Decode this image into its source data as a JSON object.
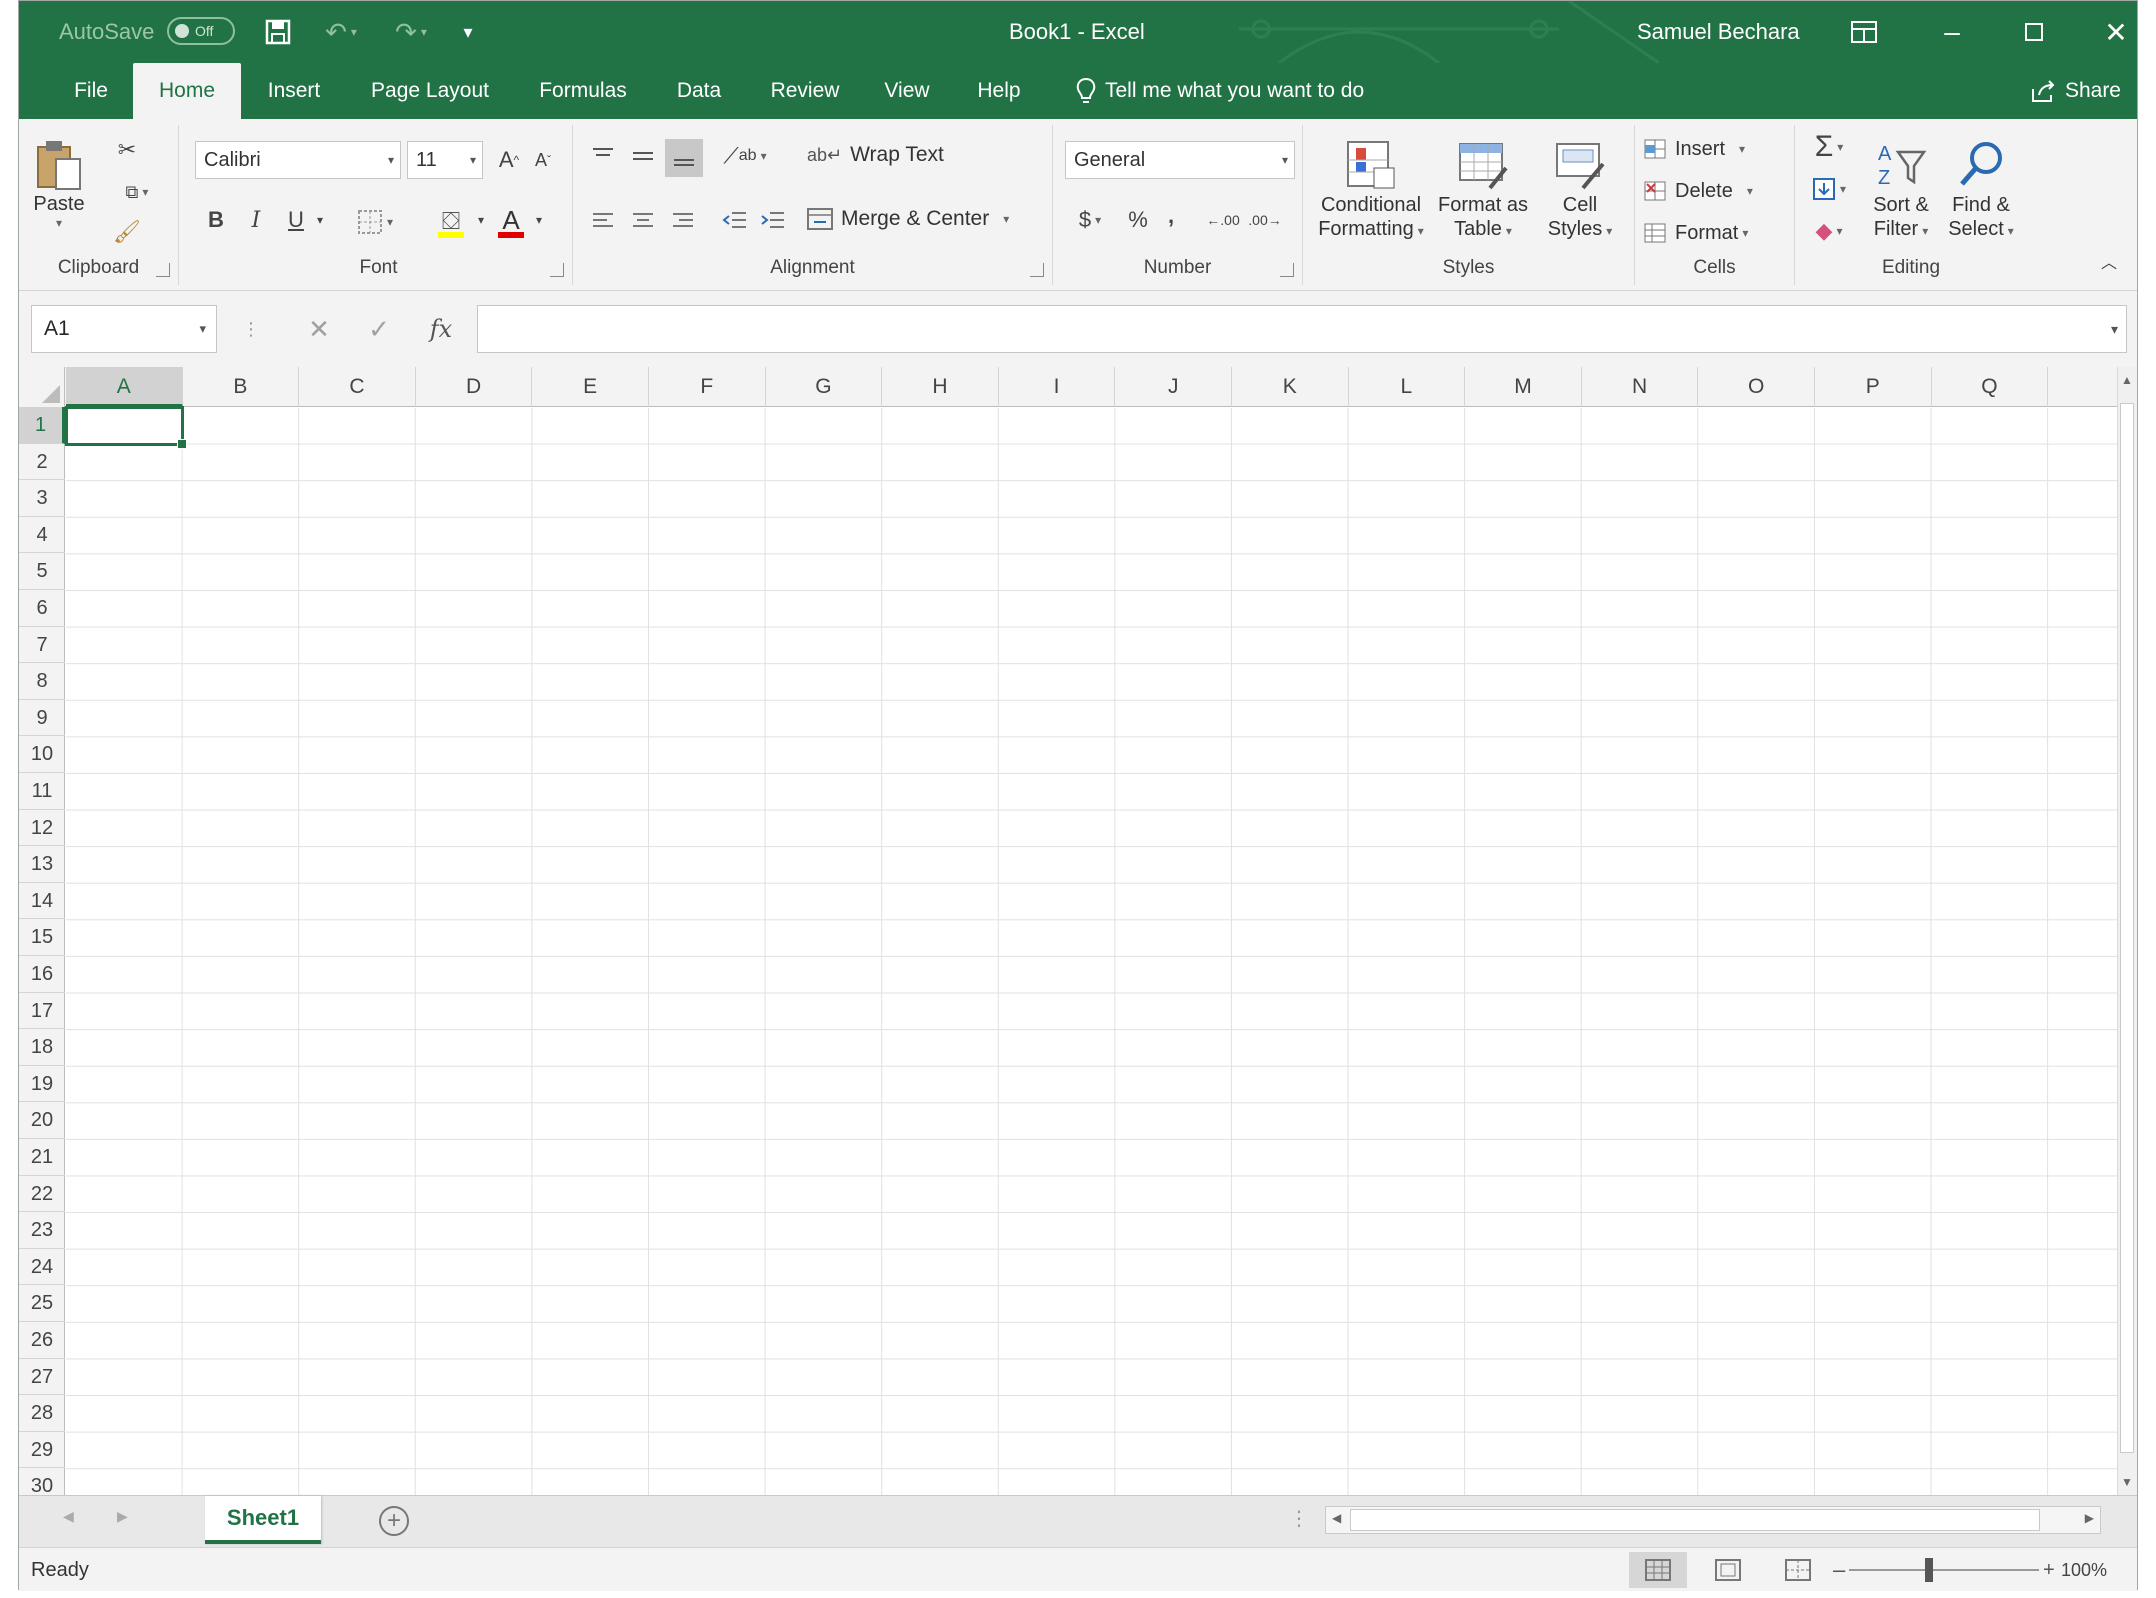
{
  "titlebar": {
    "autosave_label": "AutoSave",
    "autosave_state": "Off",
    "doc_title": "Book1  -  Excel",
    "user_name": "Samuel Bechara",
    "accent_color": "#217346"
  },
  "tabs": [
    "File",
    "Home",
    "Insert",
    "Page Layout",
    "Formulas",
    "Data",
    "Review",
    "View",
    "Help"
  ],
  "active_tab": "Home",
  "tell_me": "Tell me what you want to do",
  "share_label": "Share",
  "ribbon": {
    "clipboard": {
      "label": "Clipboard",
      "paste": "Paste"
    },
    "font": {
      "label": "Font",
      "font_name": "Calibri",
      "font_size": "11",
      "bold": "B",
      "italic": "I",
      "underline": "U",
      "grow": "A",
      "shrink": "A",
      "font_color_glyph": "A"
    },
    "alignment": {
      "label": "Alignment",
      "wrap_text": "Wrap Text",
      "merge_center": "Merge & Center"
    },
    "number": {
      "label": "Number",
      "format": "General",
      "currency": "$",
      "percent": "%",
      "comma": ",",
      "inc_dec": ".00",
      "dec_dec": ".00"
    },
    "styles": {
      "label": "Styles",
      "conditional_1": "Conditional",
      "conditional_2": "Formatting",
      "format_table_1": "Format as",
      "format_table_2": "Table",
      "cell_styles_1": "Cell",
      "cell_styles_2": "Styles"
    },
    "cells": {
      "label": "Cells",
      "insert": "Insert",
      "delete": "Delete",
      "format": "Format"
    },
    "editing": {
      "label": "Editing",
      "sigma": "Σ",
      "sort_1": "Sort &",
      "sort_2": "Filter",
      "find_1": "Find &",
      "find_2": "Select"
    }
  },
  "formula_bar": {
    "name_box": "A1",
    "fx": "fx",
    "value": ""
  },
  "columns": [
    "A",
    "B",
    "C",
    "D",
    "E",
    "F",
    "G",
    "H",
    "I",
    "J",
    "K",
    "L",
    "M",
    "N",
    "O",
    "P",
    "Q"
  ],
  "rows": [
    "1",
    "2",
    "3",
    "4",
    "5",
    "6",
    "7",
    "8",
    "9",
    "10",
    "11",
    "12",
    "13",
    "14",
    "15",
    "16",
    "17",
    "18",
    "19",
    "20",
    "21",
    "22",
    "23",
    "24",
    "25",
    "26",
    "27",
    "28",
    "29",
    "30"
  ],
  "sheets": [
    "Sheet1"
  ],
  "status": {
    "text": "Ready",
    "zoom": "100%"
  }
}
